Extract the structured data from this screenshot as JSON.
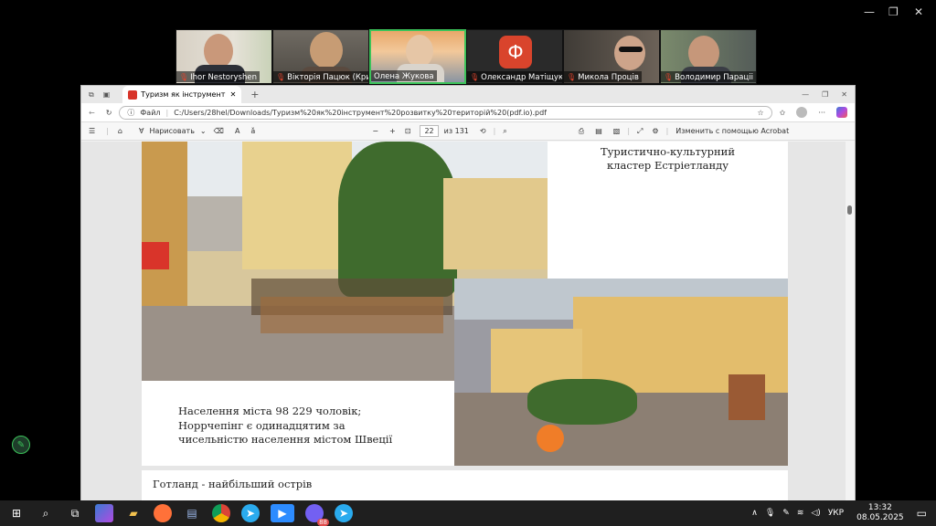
{
  "window_controls": {
    "minimize": "—",
    "restore": "❐",
    "close": "✕"
  },
  "participants": [
    {
      "name": "Ihor Nestoryshen"
    },
    {
      "name": "Вікторія Пацюк (Крив..."
    },
    {
      "name": "Олена Жукова"
    },
    {
      "name": "Олександр Матіщук",
      "avatar_letter": "Ф"
    },
    {
      "name": "Микола Проців"
    },
    {
      "name": "Володимир Параціі"
    }
  ],
  "browser": {
    "tab_title": "Туризм як інструмент розвитку",
    "tab_close": "✕",
    "new_tab": "+",
    "file_label": "Файл",
    "url": "C:/Users/28hel/Downloads/Туризм%20як%20інструмент%20розвитку%20територій%20(pdf.io).pdf",
    "window": {
      "minimize": "—",
      "restore": "❐",
      "close": "✕"
    }
  },
  "pdf_toolbar": {
    "draw_label": "Нарисовать",
    "page_current": "22",
    "page_total": "из 131",
    "acrobat_label": "Изменить с помощью Acrobat"
  },
  "slide": {
    "title_line1": "Туристично-культурний",
    "title_line2": "кластер Естріетланду",
    "text_line1": "Населення міста 98 229 чоловік;",
    "text_line2": "Норрчепінг є одинадцятим за",
    "text_line3": "чисельністю населення містом Швеції",
    "next_page_text": "Готланд - найбільший острів"
  },
  "taskbar": {
    "language": "УКР",
    "time": "13:32",
    "date": "08.05.2025",
    "viber_badge": "88"
  }
}
